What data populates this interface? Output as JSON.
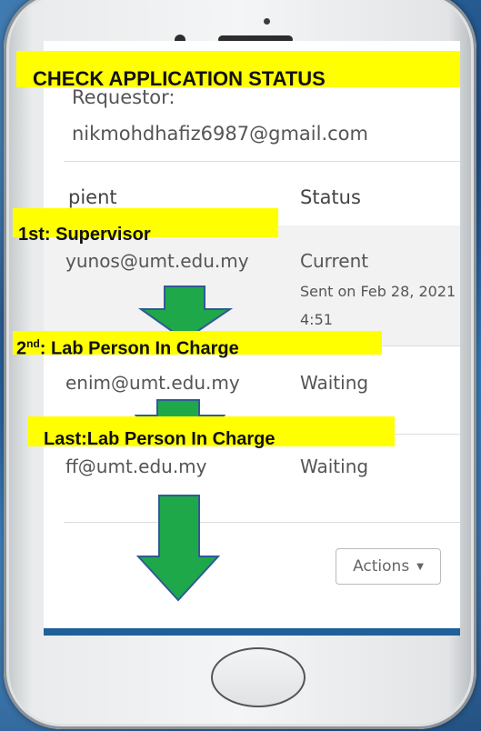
{
  "title_banner": "CHECK APPLICATION STATUS",
  "requestor": {
    "label": "Requestor:",
    "email": "nikmohdhafiz6987@gmail.com"
  },
  "table": {
    "headers": [
      "pient",
      "Status"
    ],
    "rows": [
      {
        "recipient": "yunos@umt.edu.my",
        "status": "Current",
        "detail": "Sent on Feb 28, 2021",
        "detail2": "4:51"
      },
      {
        "recipient": "enim@umt.edu.my",
        "status": "Waiting"
      },
      {
        "recipient": "ff@umt.edu.my",
        "status": "Waiting"
      }
    ]
  },
  "actions_label": "Actions",
  "annotations": {
    "step1": "1st: Supervisor",
    "step2_num": "2",
    "step2_sup": "nd",
    "step2_text": ": Lab Person In Charge",
    "step3": "Last:Lab Person In Charge"
  },
  "colors": {
    "banner": "#ffff00",
    "arrow_fill": "#1fa84a",
    "arrow_stroke": "#2f5b94"
  },
  "icons": {
    "actions_caret": "caret-down-icon"
  }
}
